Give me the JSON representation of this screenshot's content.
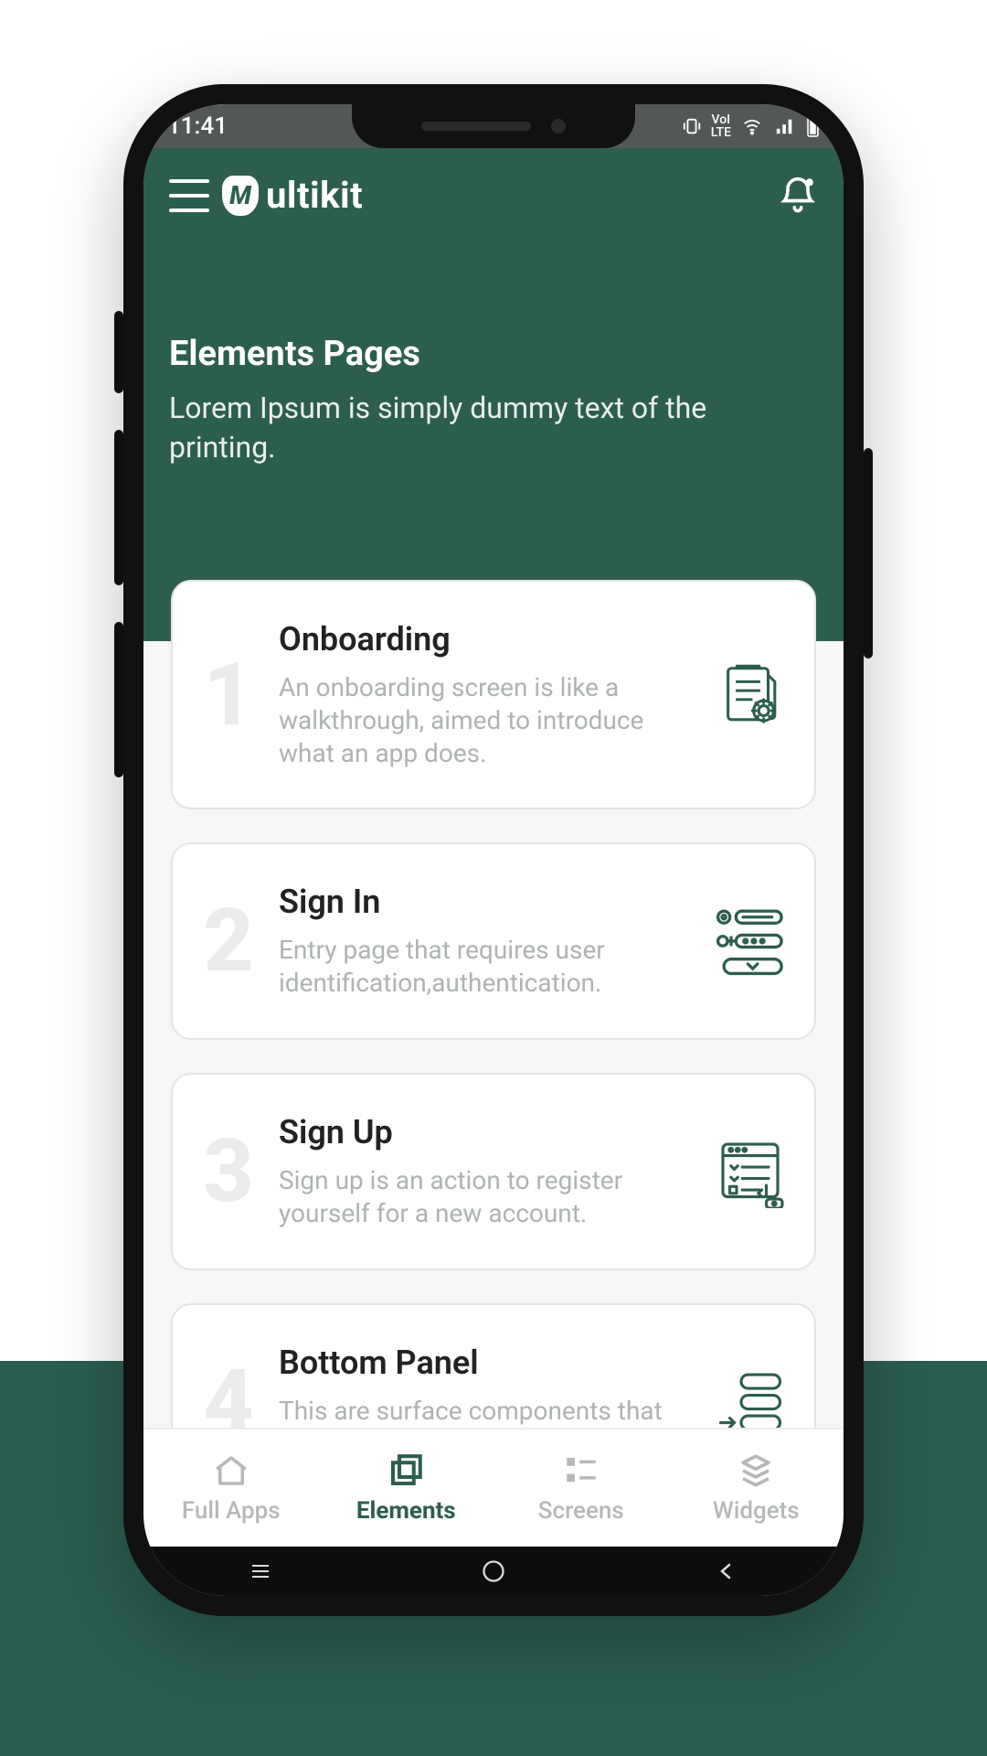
{
  "statusbar": {
    "time": "11:41"
  },
  "brand": {
    "name": "ultikit",
    "logo_letter": "M"
  },
  "page": {
    "title": "Elements Pages",
    "subtitle": "Lorem Ipsum is simply dummy text of the printing."
  },
  "cards": [
    {
      "num": "1",
      "title": "Onboarding",
      "desc": "An onboarding screen is like a walkthrough, aimed to introduce what an app does."
    },
    {
      "num": "2",
      "title": "Sign In",
      "desc": "Entry page that requires user identification,authentication."
    },
    {
      "num": "3",
      "title": "Sign Up",
      "desc": "Sign up is an action to register yourself for a new account."
    },
    {
      "num": "4",
      "title": "Bottom Panel",
      "desc": "This are surface components that hold supplementary screen content."
    }
  ],
  "nav": [
    {
      "label": "Full Apps"
    },
    {
      "label": "Elements"
    },
    {
      "label": "Screens"
    },
    {
      "label": "Widgets"
    }
  ],
  "nav_active_index": 1
}
